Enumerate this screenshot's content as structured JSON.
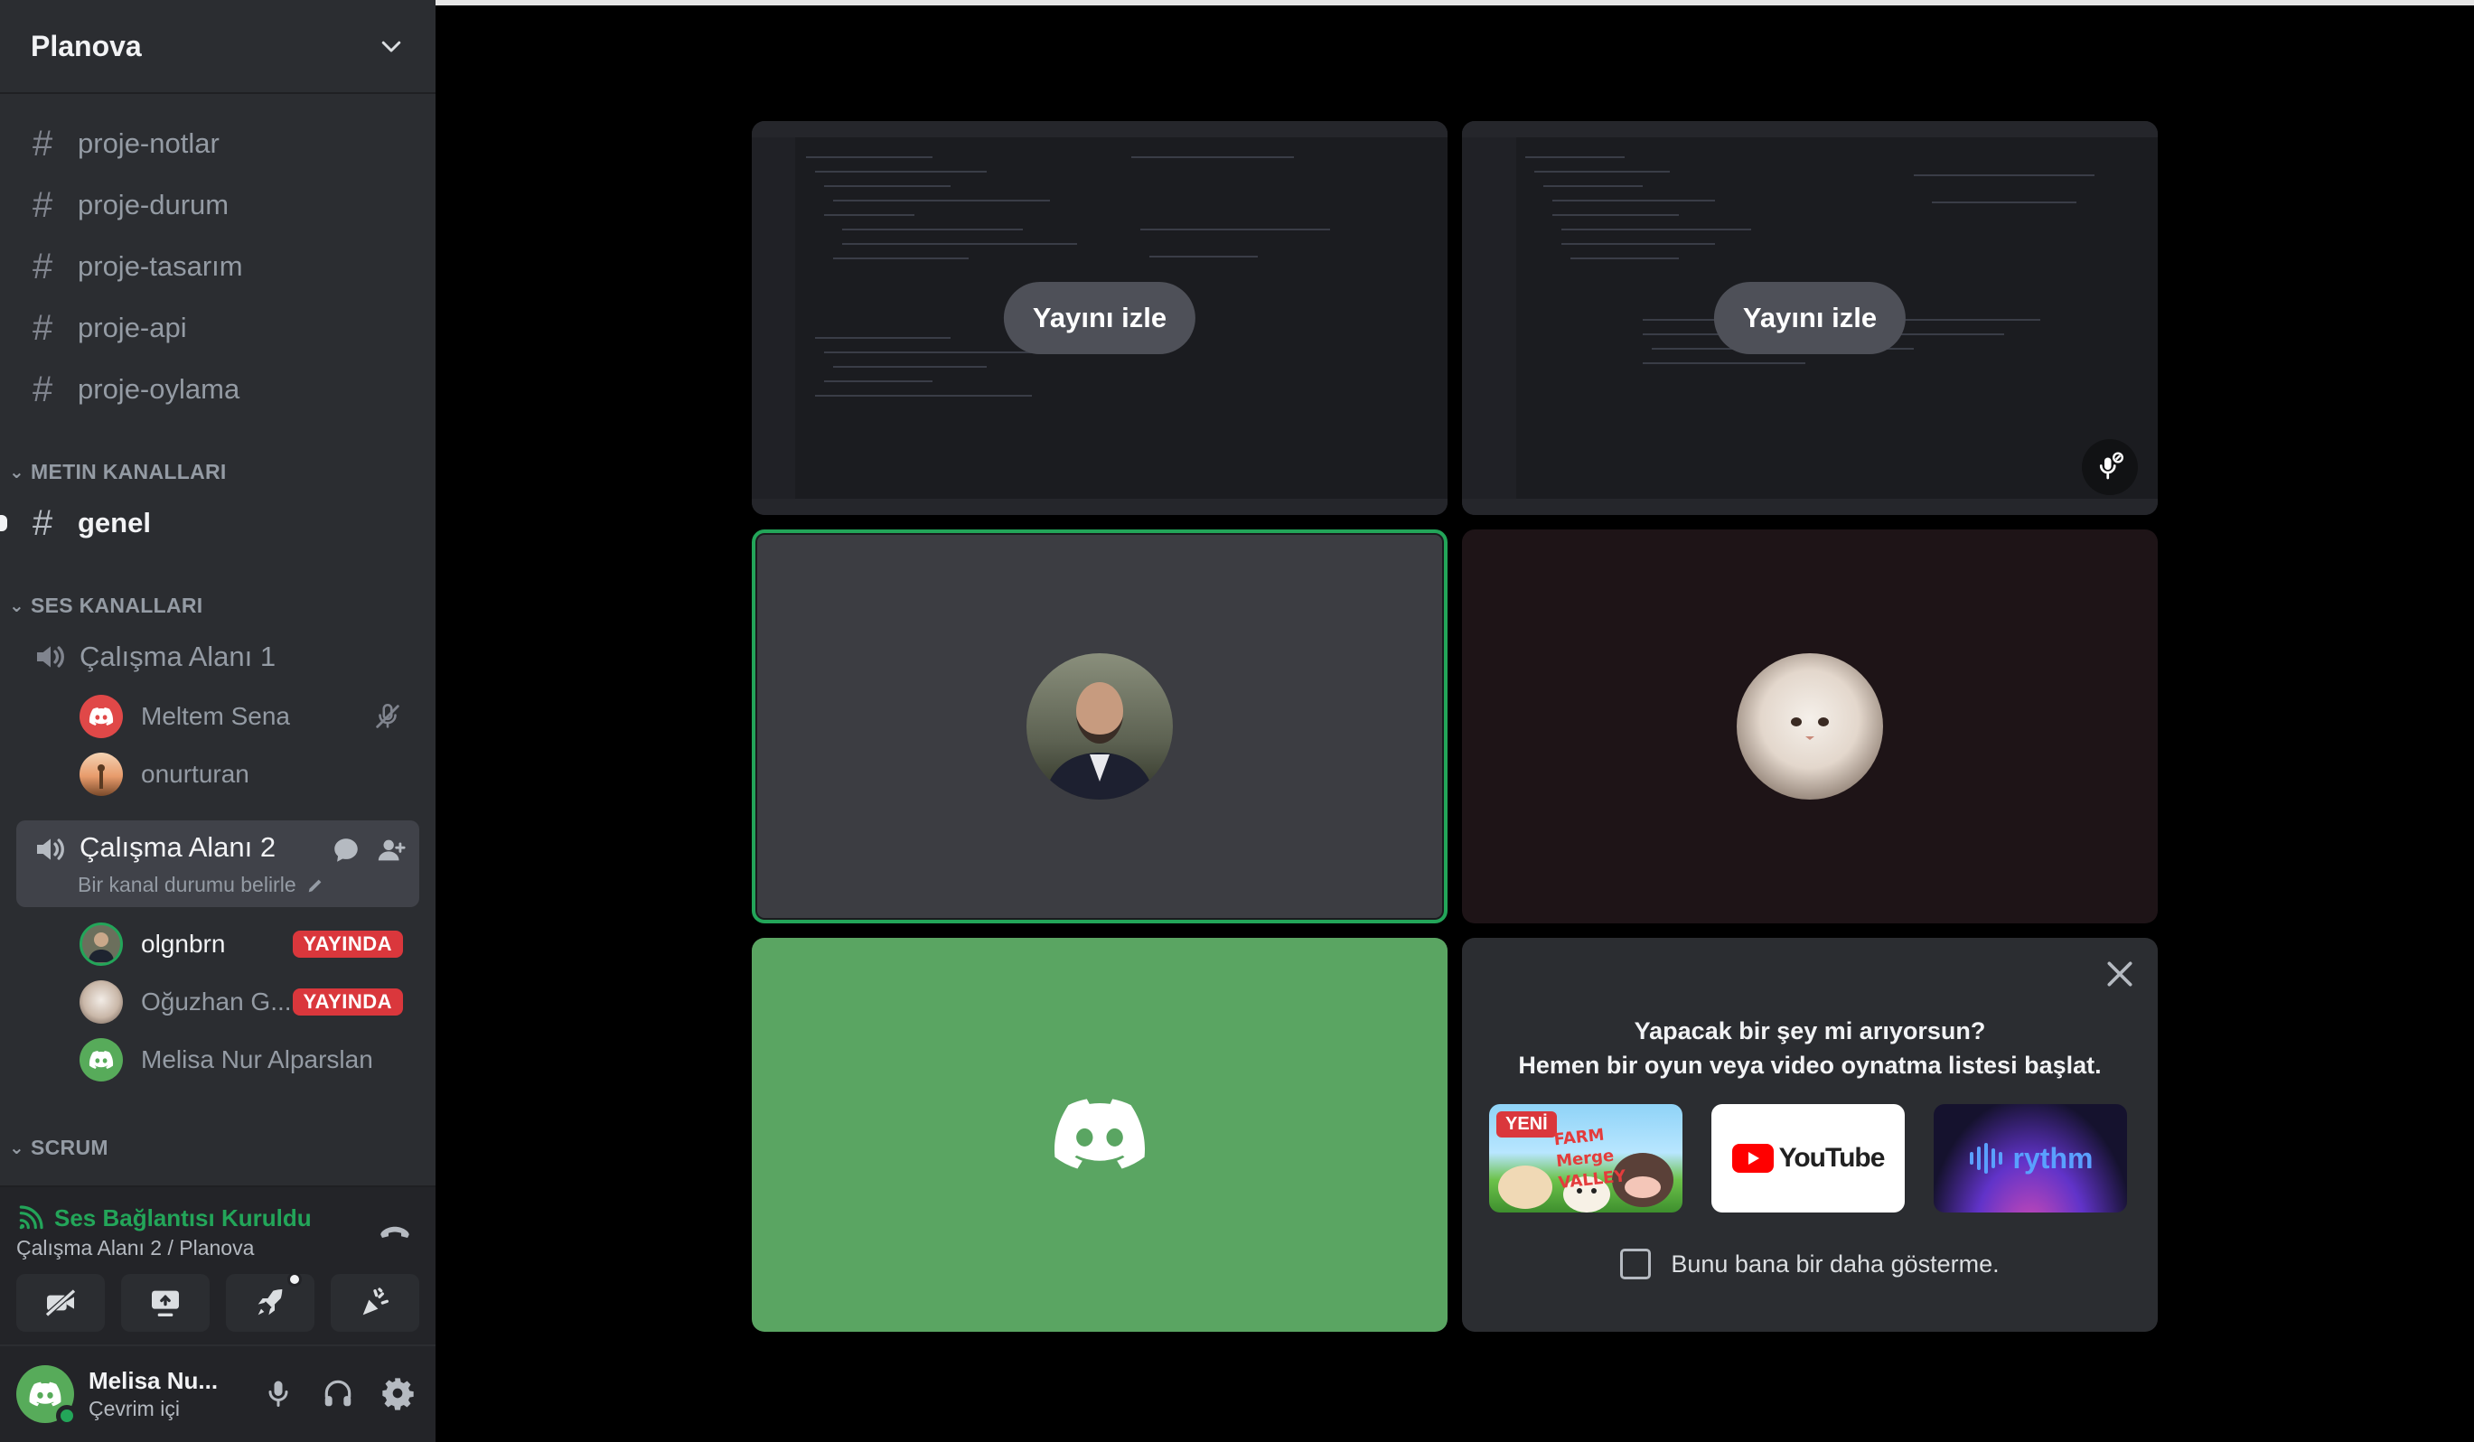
{
  "server": {
    "name": "Planova"
  },
  "text_channels_top": [
    {
      "name": "proje-notlar"
    },
    {
      "name": "proje-durum"
    },
    {
      "name": "proje-tasarım"
    },
    {
      "name": "proje-api"
    },
    {
      "name": "proje-oylama"
    }
  ],
  "categories": {
    "text": "METIN KANALLARI",
    "voice": "SES KANALLARI",
    "scrum": "SCRUM"
  },
  "text_channels": [
    {
      "name": "genel"
    }
  ],
  "voice_channels": [
    {
      "name": "Çalışma Alanı 1",
      "members": [
        {
          "name": "Meltem Sena",
          "muted": true
        },
        {
          "name": "onurturan"
        }
      ]
    },
    {
      "name": "Çalışma Alanı 2",
      "status": "Bir kanal durumu belirle",
      "members": [
        {
          "name": "olgnbrn",
          "badge": "YAYINDA"
        },
        {
          "name": "Oğuzhan G...",
          "badge": "YAYINDA"
        },
        {
          "name": "Melisa Nur Alparslan"
        }
      ]
    }
  ],
  "voice_connection": {
    "status": "Ses Bağlantısı Kuruldu",
    "channel": "Çalışma Alanı 2 / Planova"
  },
  "user": {
    "name": "Melisa Nu...",
    "status": "Çevrim içi"
  },
  "stage": {
    "watch_label_1": "Yayını izle",
    "watch_label_2": "Yayını izle"
  },
  "promo": {
    "title_line1": "Yapacak bir şey mi arıyorsun?",
    "title_line2": "Hemen bir oyun veya video oynatma listesi başlat.",
    "new_badge": "YENİ",
    "game_title": "FARM Merge VALLEY",
    "youtube_label": "YouTube",
    "rythm_label": "rythm",
    "dont_show": "Bunu bana bir daha gösterme."
  },
  "colors": {
    "sidebar_bg": "#2b2d31",
    "connected_green": "#23a559",
    "live_red": "#da373c",
    "tile_green": "#5aa562"
  }
}
